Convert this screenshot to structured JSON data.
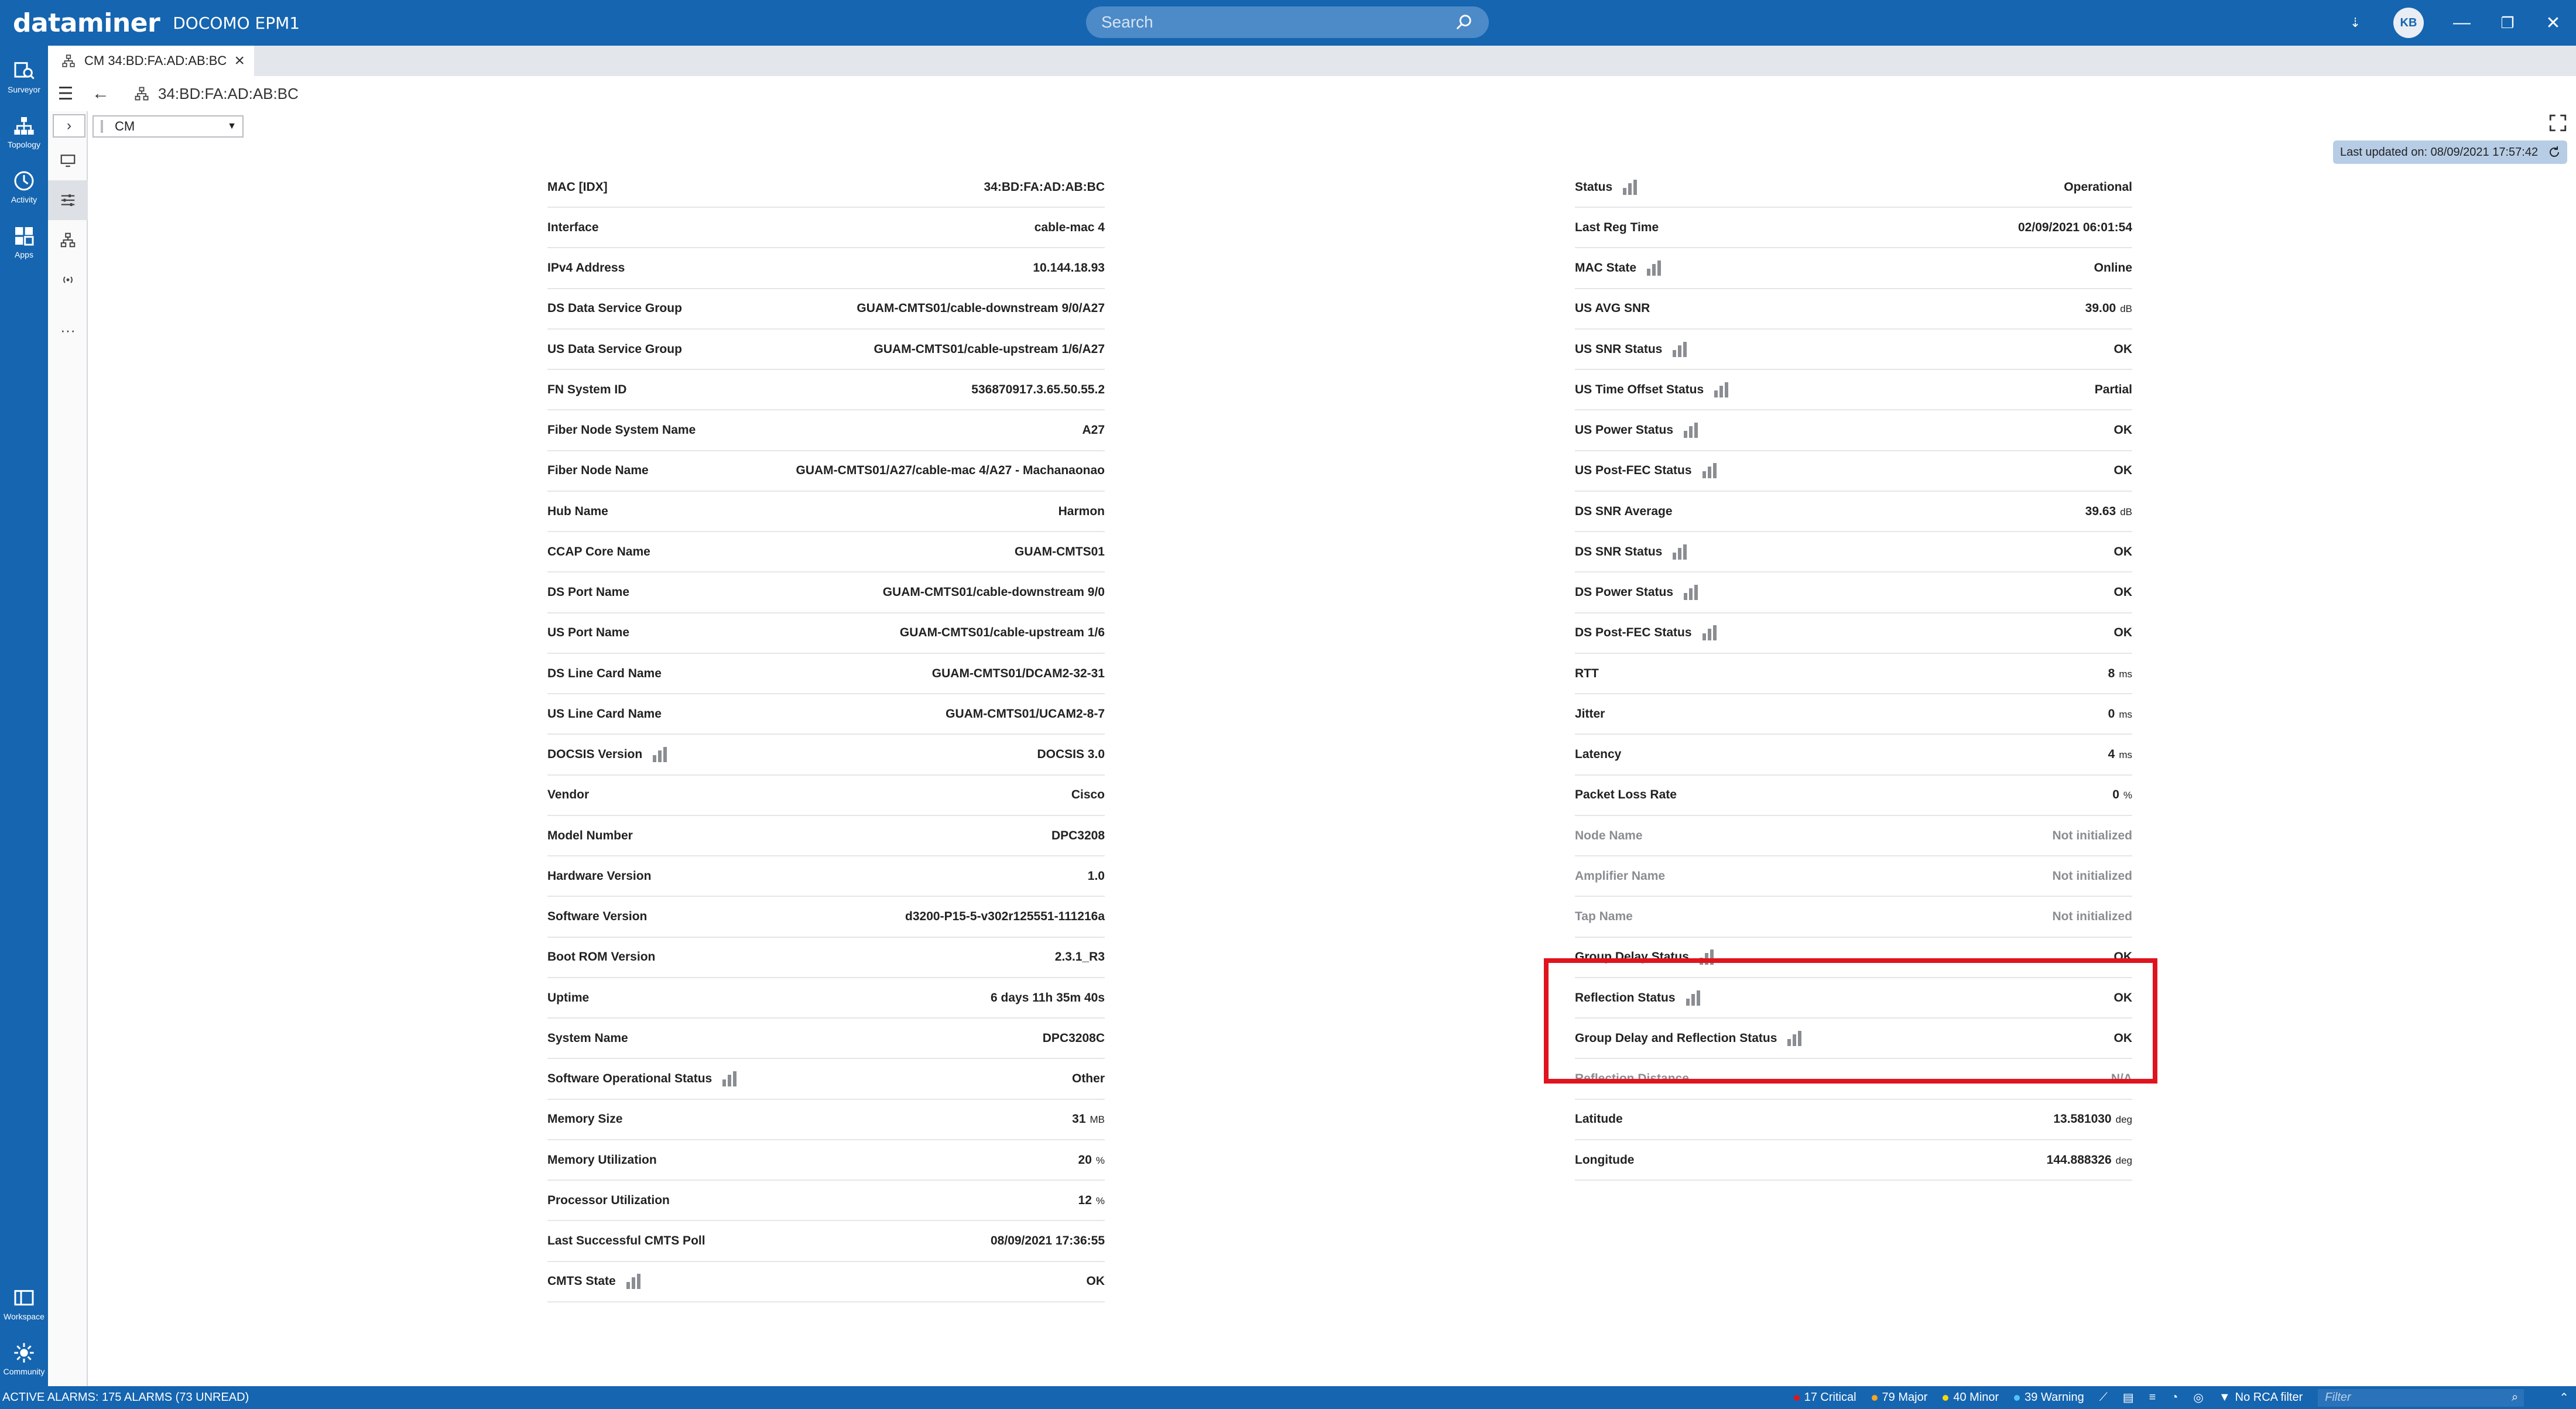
{
  "app": {
    "logo": "dataminer",
    "name": "DOCOMO EPM1"
  },
  "search": {
    "placeholder": "Search"
  },
  "user": {
    "initials": "KB"
  },
  "nav": [
    {
      "label": "Surveyor",
      "icon": "surveyor-icon"
    },
    {
      "label": "Topology",
      "icon": "topology-icon"
    },
    {
      "label": "Activity",
      "icon": "activity-icon"
    },
    {
      "label": "Apps",
      "icon": "apps-icon"
    }
  ],
  "nav_bottom": [
    {
      "label": "Workspace",
      "icon": "workspace-icon"
    },
    {
      "label": "Community",
      "icon": "community-icon"
    }
  ],
  "tab": {
    "label": "CM 34:BD:FA:AD:AB:BC"
  },
  "card": {
    "breadcrumb": "34:BD:FA:AD:AB:BC",
    "view": "CM"
  },
  "last_updated": "Last updated on: 08/09/2021 17:57:42",
  "left_params": [
    {
      "label": "MAC [IDX]",
      "value": "34:BD:FA:AD:AB:BC"
    },
    {
      "label": "Interface",
      "value": "cable-mac 4"
    },
    {
      "label": "IPv4 Address",
      "value": "10.144.18.93"
    },
    {
      "label": "DS Data Service Group",
      "value": "GUAM-CMTS01/cable-downstream 9/0/A27"
    },
    {
      "label": "US Data Service Group",
      "value": "GUAM-CMTS01/cable-upstream 1/6/A27"
    },
    {
      "label": "FN System ID",
      "value": "536870917.3.65.50.55.2"
    },
    {
      "label": "Fiber Node System Name",
      "value": "A27"
    },
    {
      "label": "Fiber Node Name",
      "value": "GUAM-CMTS01/A27/cable-mac 4/A27 - Machanaonao"
    },
    {
      "label": "Hub Name",
      "value": "Harmon"
    },
    {
      "label": "CCAP Core Name",
      "value": "GUAM-CMTS01"
    },
    {
      "label": "DS Port Name",
      "value": "GUAM-CMTS01/cable-downstream 9/0"
    },
    {
      "label": "US Port Name",
      "value": "GUAM-CMTS01/cable-upstream 1/6"
    },
    {
      "label": "DS Line Card Name",
      "value": "GUAM-CMTS01/DCAM2-32-31"
    },
    {
      "label": "US Line Card Name",
      "value": "GUAM-CMTS01/UCAM2-8-7"
    },
    {
      "label": "DOCSIS Version",
      "value": "DOCSIS 3.0",
      "trend": true
    },
    {
      "label": "Vendor",
      "value": "Cisco"
    },
    {
      "label": "Model Number",
      "value": "DPC3208"
    },
    {
      "label": "Hardware Version",
      "value": "1.0"
    },
    {
      "label": "Software Version",
      "value": "d3200-P15-5-v302r125551-111216a"
    },
    {
      "label": "Boot ROM Version",
      "value": "2.3.1_R3"
    },
    {
      "label": "Uptime",
      "value": "6 days 11h 35m 40s"
    },
    {
      "label": "System Name",
      "value": "DPC3208C"
    },
    {
      "label": "Software Operational Status",
      "value": "Other",
      "trend": true
    },
    {
      "label": "Memory Size",
      "value": "31",
      "unit": "MB"
    },
    {
      "label": "Memory Utilization",
      "value": "20",
      "unit": "%"
    },
    {
      "label": "Processor Utilization",
      "value": "12",
      "unit": "%"
    },
    {
      "label": "Last Successful CMTS Poll",
      "value": "08/09/2021 17:36:55"
    },
    {
      "label": "CMTS State",
      "value": "OK",
      "trend": true
    }
  ],
  "right_params": [
    {
      "label": "Status",
      "value": "Operational",
      "trend": true
    },
    {
      "label": "Last Reg Time",
      "value": "02/09/2021 06:01:54"
    },
    {
      "label": "MAC State",
      "value": "Online",
      "trend": true
    },
    {
      "label": "US AVG SNR",
      "value": "39.00",
      "unit": "dB"
    },
    {
      "label": "US SNR Status",
      "value": "OK",
      "trend": true
    },
    {
      "label": "US Time Offset Status",
      "value": "Partial",
      "trend": true
    },
    {
      "label": "US Power Status",
      "value": "OK",
      "trend": true
    },
    {
      "label": "US Post-FEC Status",
      "value": "OK",
      "trend": true
    },
    {
      "label": "DS SNR Average",
      "value": "39.63",
      "unit": "dB"
    },
    {
      "label": "DS SNR Status",
      "value": "OK",
      "trend": true
    },
    {
      "label": "DS Power Status",
      "value": "OK",
      "trend": true
    },
    {
      "label": "DS Post-FEC Status",
      "value": "OK",
      "trend": true
    },
    {
      "label": "RTT",
      "value": "8",
      "unit": "ms"
    },
    {
      "label": "Jitter",
      "value": "0",
      "unit": "ms"
    },
    {
      "label": "Latency",
      "value": "4",
      "unit": "ms"
    },
    {
      "label": "Packet Loss Rate",
      "value": "0",
      "unit": "%"
    },
    {
      "label": "Node Name",
      "value": "Not initialized",
      "dim": true
    },
    {
      "label": "Amplifier Name",
      "value": "Not initialized",
      "dim": true
    },
    {
      "label": "Tap Name",
      "value": "Not initialized",
      "dim": true
    },
    {
      "label": "Group Delay Status",
      "value": "OK",
      "trend": true
    },
    {
      "label": "Reflection Status",
      "value": "OK",
      "trend": true
    },
    {
      "label": "Group Delay and Reflection Status",
      "value": "OK",
      "trend": true
    },
    {
      "label": "Reflection Distance",
      "value": "N/A",
      "dim": true
    },
    {
      "label": "Latitude",
      "value": "13.581030",
      "unit": "deg"
    },
    {
      "label": "Longitude",
      "value": "144.888326",
      "unit": "deg"
    }
  ],
  "statusbar": {
    "alarms": "ACTIVE ALARMS: 175 ALARMS (73 UNREAD)",
    "critical": "17 Critical",
    "major": "79 Major",
    "minor": "40 Minor",
    "warning": "39 Warning",
    "rca": "No RCA filter",
    "filter_placeholder": "Filter"
  },
  "colors": {
    "brand": "#1565b0",
    "highlight": "#e0141e",
    "critical": "#e0141e",
    "major": "#f5a623",
    "minor": "#f5d90a",
    "warning": "#4fc3f7"
  }
}
